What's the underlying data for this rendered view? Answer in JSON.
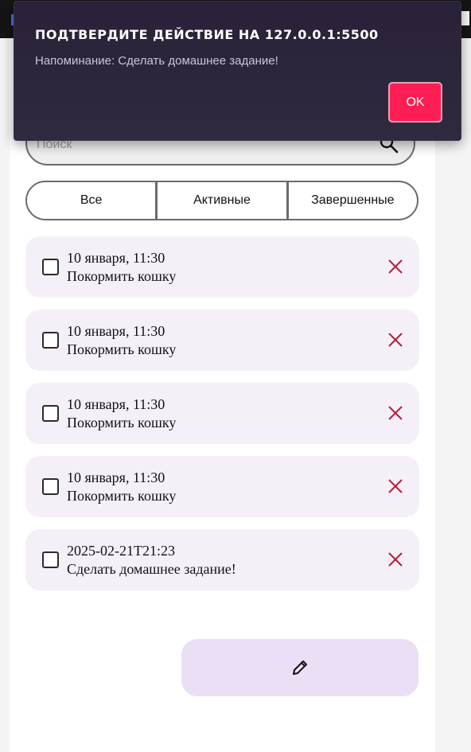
{
  "dialog": {
    "title": "ПОДТВЕРДИТЕ ДЕЙСТВИЕ НА 127.0.0.1:5500",
    "message": "Напоминание: Сделать домашнее задание!",
    "ok_label": "OK"
  },
  "search": {
    "placeholder": "Поиск"
  },
  "filters": [
    {
      "label": "Все"
    },
    {
      "label": "Активные"
    },
    {
      "label": "Завершенные"
    }
  ],
  "tasks": [
    {
      "datetime": "10 января, 11:30",
      "title": "Покормить кошку",
      "done": false
    },
    {
      "datetime": "10 января, 11:30",
      "title": "Покормить кошку",
      "done": false
    },
    {
      "datetime": "10 января, 11:30",
      "title": "Покормить кошку",
      "done": false
    },
    {
      "datetime": "10 января, 11:30",
      "title": "Покормить кошку",
      "done": false
    },
    {
      "datetime": "2025-02-21T21:23",
      "title": "Сделать домашнее задание!",
      "done": false
    }
  ],
  "icons": {
    "search": "search-icon",
    "delete": "close-icon",
    "edit": "pencil-icon"
  },
  "colors": {
    "accent": "#ff1e54",
    "delete_icon": "#b5213a",
    "task_bg": "#f5f0f8",
    "edit_bg": "#ebdff6"
  }
}
